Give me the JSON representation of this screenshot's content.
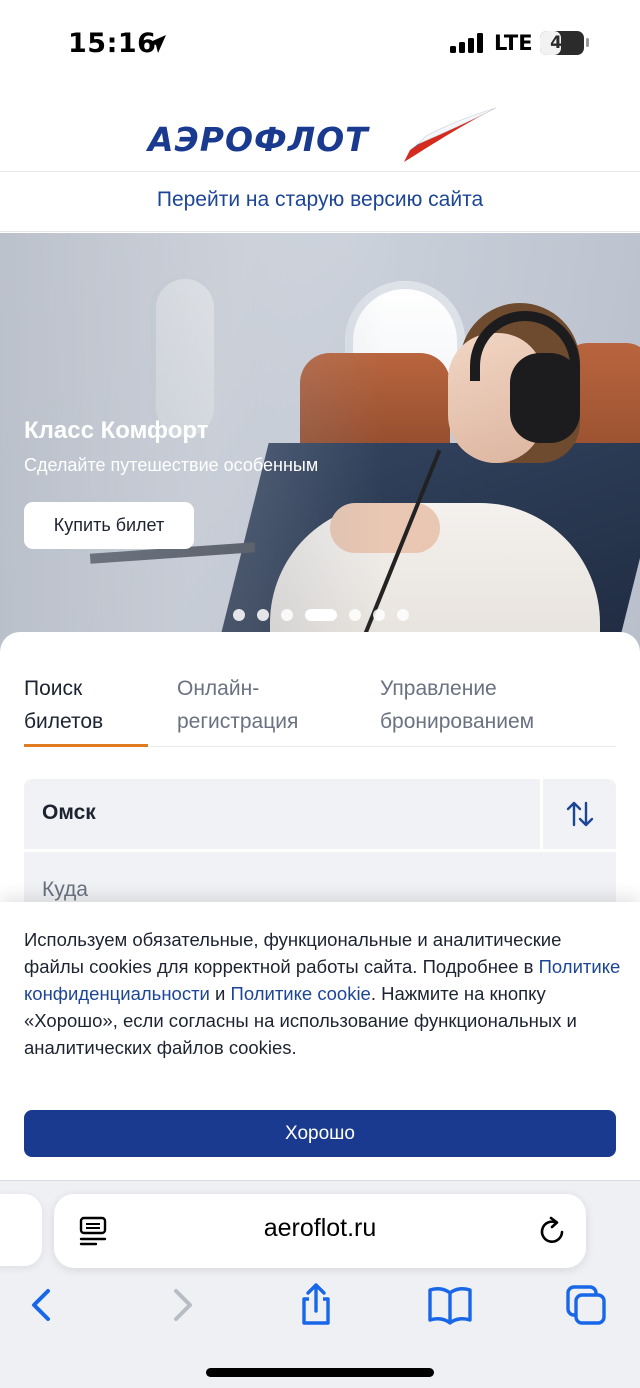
{
  "status_bar": {
    "time": "15:16",
    "network": "LTE",
    "battery_percent": 47,
    "battery_label": "47",
    "icons": [
      "location-arrow-icon",
      "cellular-signal-icon",
      "battery-icon"
    ]
  },
  "header": {
    "logo_text": "АЭРОФЛОТ",
    "old_version_link": "Перейти на старую версию сайта",
    "colors": {
      "brand_blue": "#1a3a8f",
      "link_blue": "#1d4596"
    }
  },
  "hero": {
    "title": "Класс Комфорт",
    "subtitle": "Сделайте путешествие особенным",
    "button_label": "Купить билет",
    "slide_count": 7,
    "active_slide": 4
  },
  "booking": {
    "tabs": [
      {
        "label_line1": "Поиск",
        "label_line2": "билетов",
        "active": true
      },
      {
        "label_line1": "Онлайн-",
        "label_line2": "регистрация",
        "active": false
      },
      {
        "label_line1": "Управление",
        "label_line2": "бронированием",
        "active": false
      }
    ],
    "from_value": "Омск",
    "to_placeholder": "Куда",
    "accent_color": "#e07b1e"
  },
  "cookie_banner": {
    "text_1": "Используем обязательные, функциональные и аналитические файлы cookies для корректной работы сайта. Подробнее в ",
    "link_1": "Политике конфиденциальности",
    "text_2": " и ",
    "link_2": "Политике cookie",
    "text_3": ". Нажмите на кнопку «Хорошо», если согласны на использование функциональных и аналитических файлов cookies.",
    "ok_button": "Хорошо"
  },
  "browser": {
    "address": "aeroflot.ru",
    "toolbar_icons": [
      "back-icon",
      "forward-icon",
      "share-icon",
      "bookmarks-icon",
      "tabs-icon"
    ]
  }
}
